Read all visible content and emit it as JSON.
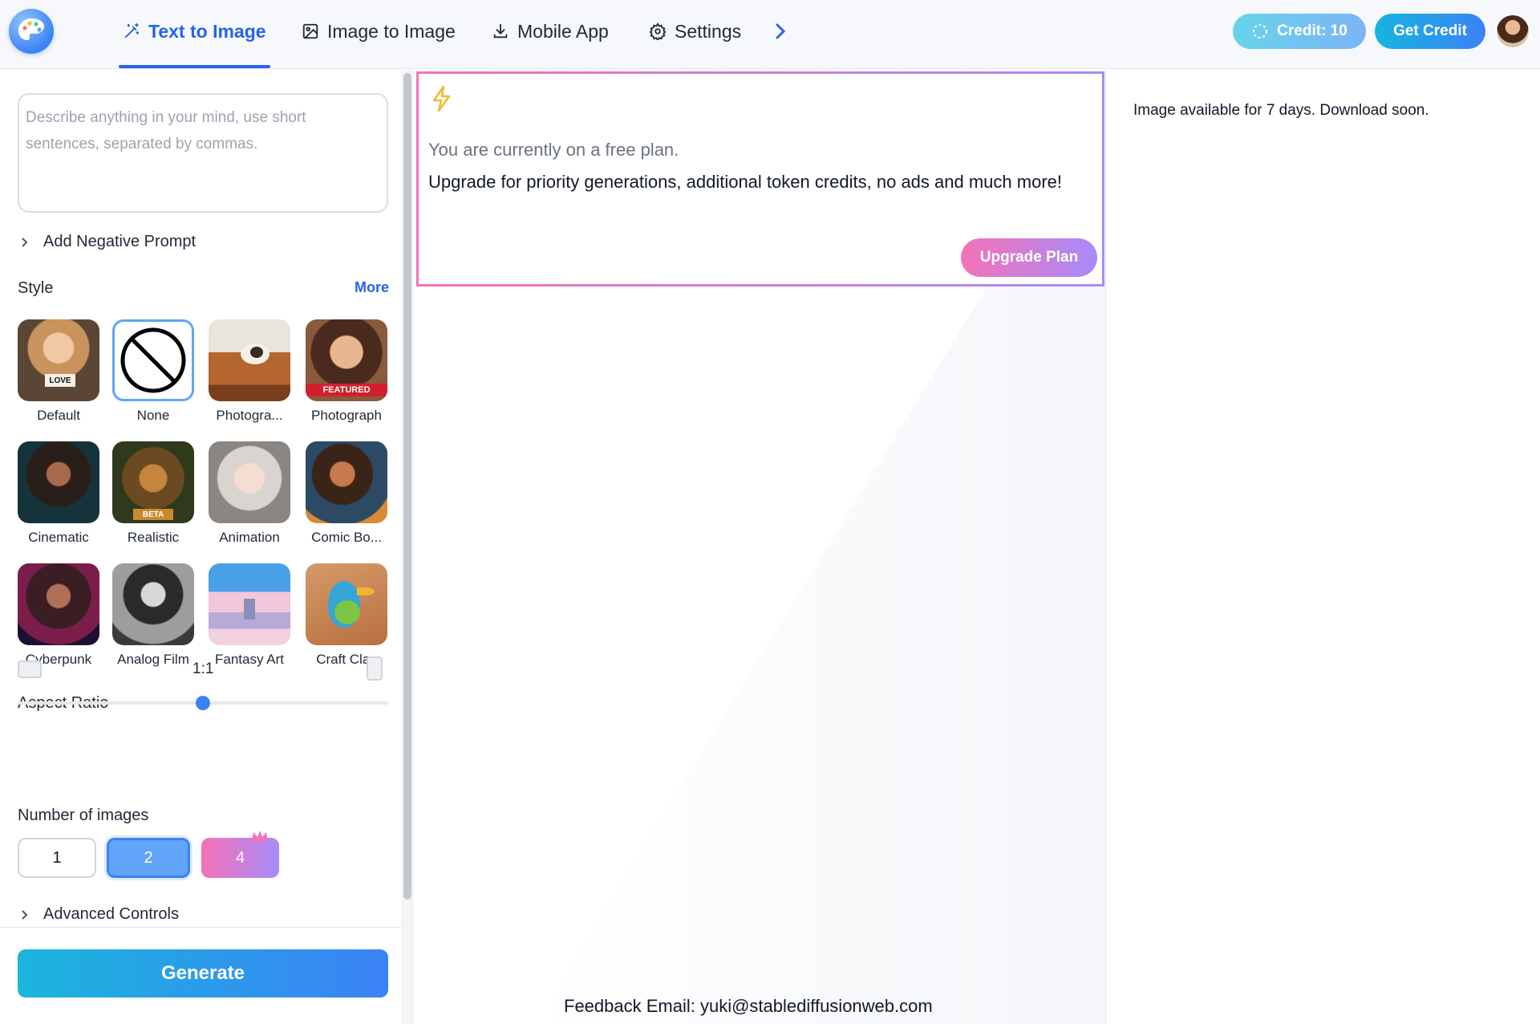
{
  "header": {
    "tabs": [
      {
        "label": "Text to Image",
        "icon": "magic-wand-icon",
        "active": true
      },
      {
        "label": "Image to Image",
        "icon": "image-icon",
        "active": false
      },
      {
        "label": "Mobile App",
        "icon": "download-icon",
        "active": false
      },
      {
        "label": "Settings",
        "icon": "gear-icon",
        "active": false
      }
    ],
    "credit_label": "Credit: 10",
    "get_credit_label": "Get Credit"
  },
  "prompt": {
    "placeholder": "Describe anything in your mind, use short sentences, separated by commas."
  },
  "negative_prompt_label": "Add Negative Prompt",
  "style": {
    "title": "Style",
    "more_label": "More",
    "items": [
      {
        "label": "Default"
      },
      {
        "label": "None",
        "selected": true
      },
      {
        "label": "Photogra..."
      },
      {
        "label": "Photograph",
        "badge": "FEATURED"
      },
      {
        "label": "Cinematic"
      },
      {
        "label": "Realistic",
        "badge": "BETA"
      },
      {
        "label": "Animation"
      },
      {
        "label": "Comic Bo..."
      },
      {
        "label": "Cyberpunk"
      },
      {
        "label": "Analog Film"
      },
      {
        "label": "Fantasy Art"
      },
      {
        "label": "Craft Clay"
      }
    ],
    "default_thumb_text": "LOVE"
  },
  "aspect_ratio": {
    "title": "Aspect Ratio",
    "value": "1:1",
    "slider_fraction": 0.5
  },
  "number_of_images": {
    "title": "Number of images",
    "options": [
      "1",
      "2",
      "4"
    ],
    "selected": "2"
  },
  "advanced_controls_label": "Advanced Controls",
  "generate_label": "Generate",
  "upgrade": {
    "free_plan_text": "You are currently on a free plan.",
    "message": "Upgrade for priority generations, additional token credits, no ads and much more!",
    "button_label": "Upgrade Plan"
  },
  "feedback": "Feedback Email: yuki@stablediffusionweb.com",
  "right_panel": {
    "availability": "Image available for 7 days. Download soon."
  },
  "colors": {
    "accent": "#2563eb",
    "brand_gradient_start": "#1bb5dc",
    "brand_gradient_end": "#3b82f6",
    "upgrade_gradient_start": "#f472b6",
    "upgrade_gradient_end": "#a78bfa"
  }
}
